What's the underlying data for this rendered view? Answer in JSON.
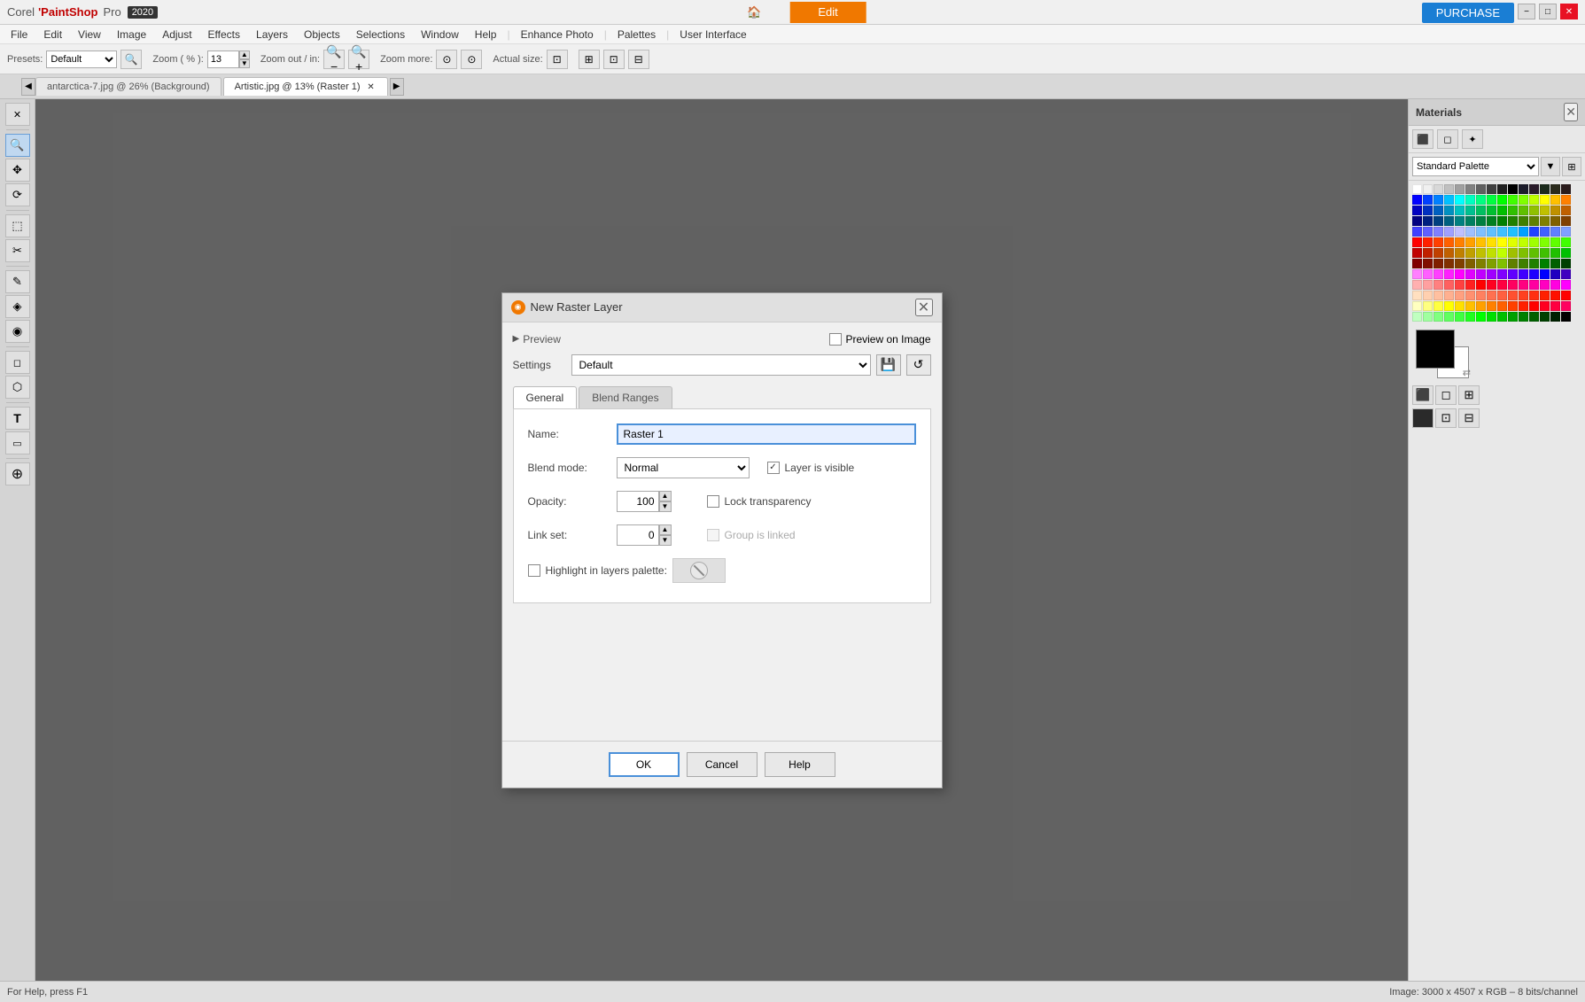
{
  "app": {
    "title": "Corel PaintShop Pro 2020",
    "corel": "Corel",
    "paintshop": "'PaintShop",
    "pro": "Pro",
    "year": "2020"
  },
  "titlebar": {
    "home_label": "🏠",
    "edit_label": "Edit",
    "purchase_label": "PURCHASE",
    "min_label": "−",
    "max_label": "□",
    "close_label": "✕"
  },
  "menubar": {
    "items": [
      "File",
      "Edit",
      "View",
      "Image",
      "Adjust",
      "Effects",
      "Layers",
      "Objects",
      "Selections",
      "Window",
      "Help",
      "Enhance Photo",
      "Palettes",
      "User Interface"
    ]
  },
  "toolbar": {
    "presets_label": "Presets:",
    "zoom_label": "Zoom ( % ):",
    "zoom_value": "13",
    "zoomout_label": "Zoom out / in:",
    "zoommore_label": "Zoom more:",
    "actualsize_label": "Actual size:"
  },
  "tabs": {
    "items": [
      {
        "label": "antarctica-7.jpg @ 26% (Background)",
        "active": false,
        "closable": false
      },
      {
        "label": "Artistic.jpg @ 13% (Raster 1)",
        "active": true,
        "closable": true
      }
    ]
  },
  "lefttools": {
    "tools": [
      "🔍",
      "⊹",
      "✏️",
      "🖊",
      "🔲",
      "✂",
      "◎",
      "✒",
      "⬡",
      "T",
      "🗑",
      "🪣"
    ]
  },
  "dialog": {
    "title": "New Raster Layer",
    "icon": "◉",
    "preview_label": "Preview",
    "preview_on_image_label": "Preview on Image",
    "settings_label": "Settings",
    "settings_default": "Default",
    "save_icon": "💾",
    "reset_icon": "↺",
    "tabs": [
      "General",
      "Blend Ranges"
    ],
    "active_tab": "General",
    "name_label": "Name:",
    "name_value": "Raster 1",
    "blend_label": "Blend mode:",
    "blend_value": "Normal",
    "opacity_label": "Opacity:",
    "opacity_value": "100",
    "linkset_label": "Link set:",
    "linkset_value": "0",
    "layer_visible_label": "Layer is visible",
    "lock_transparency_label": "Lock transparency",
    "group_linked_label": "Group is linked",
    "highlight_label": "Highlight in layers palette:",
    "ok_label": "OK",
    "cancel_label": "Cancel",
    "help_label": "Help"
  },
  "materials": {
    "title": "Materials",
    "close_icon": "✕",
    "palette_label": "Standard Palette",
    "swatches": [
      [
        "#ffffff",
        "#f0f0f0",
        "#d8d8d8",
        "#c0c0c0",
        "#a0a0a0",
        "#808080",
        "#606060",
        "#404040",
        "#202020",
        "#000000",
        "#1c1c2a",
        "#2a1c2a",
        "#1c2a1c",
        "#2a2a1c",
        "#2a1c1c"
      ],
      [
        "#0000ff",
        "#0040ff",
        "#0080ff",
        "#00c0ff",
        "#00ffff",
        "#00ffc0",
        "#00ff80",
        "#00ff40",
        "#00ff00",
        "#40ff00",
        "#80ff00",
        "#c0ff00",
        "#ffff00",
        "#ffc000",
        "#ff8000"
      ],
      [
        "#0000c0",
        "#0030c0",
        "#0060c0",
        "#0090c0",
        "#00c0c0",
        "#00c090",
        "#00c060",
        "#00c030",
        "#00c000",
        "#30c000",
        "#60c000",
        "#90c000",
        "#c0c000",
        "#c09000",
        "#c06000"
      ],
      [
        "#000080",
        "#002080",
        "#004080",
        "#006080",
        "#008080",
        "#008060",
        "#008040",
        "#008020",
        "#008000",
        "#208000",
        "#408000",
        "#608000",
        "#808000",
        "#806000",
        "#804000"
      ],
      [
        "#4040ff",
        "#6060ff",
        "#8080ff",
        "#a0a0ff",
        "#c0c0ff",
        "#a0c0ff",
        "#80c0ff",
        "#60c0ff",
        "#40c0ff",
        "#20c0ff",
        "#00a0ff",
        "#2040ff",
        "#4060ff",
        "#6080ff",
        "#80a0ff"
      ],
      [
        "#ff0000",
        "#ff2000",
        "#ff4000",
        "#ff6000",
        "#ff8000",
        "#ffa000",
        "#ffc000",
        "#ffe000",
        "#ffff00",
        "#e0ff00",
        "#c0ff00",
        "#a0ff00",
        "#80ff00",
        "#60ff00",
        "#40ff00"
      ],
      [
        "#c00000",
        "#c02000",
        "#c04000",
        "#c06000",
        "#c08000",
        "#c0a000",
        "#c0c000",
        "#c0e000",
        "#c0ff00",
        "#a0c000",
        "#80c000",
        "#60c000",
        "#40c000",
        "#20c000",
        "#00c000"
      ],
      [
        "#800000",
        "#801000",
        "#802000",
        "#803000",
        "#804000",
        "#806000",
        "#808000",
        "#80a000",
        "#80c000",
        "#608000",
        "#408000",
        "#208000",
        "#008000",
        "#006000",
        "#004000"
      ],
      [
        "#ff80ff",
        "#ff60ff",
        "#ff40ff",
        "#ff20ff",
        "#ff00ff",
        "#e000ff",
        "#c000ff",
        "#a000ff",
        "#8000ff",
        "#6000ff",
        "#4000ff",
        "#2000ff",
        "#0000ff",
        "#2000c0",
        "#4000c0"
      ],
      [
        "#ffb0b0",
        "#ffa0a0",
        "#ff8080",
        "#ff6060",
        "#ff4040",
        "#ff2020",
        "#ff0000",
        "#ff0020",
        "#ff0040",
        "#ff0060",
        "#ff0080",
        "#ff00a0",
        "#ff00c0",
        "#ff00e0",
        "#ff00ff"
      ],
      [
        "#ffe0c0",
        "#ffd0b0",
        "#ffc0a0",
        "#ffb090",
        "#ffa080",
        "#ff9070",
        "#ff8060",
        "#ff7050",
        "#ff6040",
        "#ff5030",
        "#ff4020",
        "#ff3010",
        "#ff2000",
        "#ff1000",
        "#ff0000"
      ],
      [
        "#ffffc0",
        "#ffff80",
        "#ffff40",
        "#ffff00",
        "#ffe000",
        "#ffc000",
        "#ffa000",
        "#ff8000",
        "#ff6000",
        "#ff4000",
        "#ff2000",
        "#ff0000",
        "#ff0020",
        "#ff0040",
        "#ff0060"
      ],
      [
        "#c0ffc0",
        "#a0ffa0",
        "#80ff80",
        "#60ff60",
        "#40ff40",
        "#20ff20",
        "#00ff00",
        "#00e000",
        "#00c000",
        "#00a000",
        "#008000",
        "#006000",
        "#004000",
        "#002000",
        "#000000"
      ]
    ],
    "fg_color": "#000000",
    "bg_color": "#ffffff"
  },
  "statusbar": {
    "help_text": "For Help, press F1",
    "image_info": "Image:  3000 x 4507 x RGB – 8 bits/channel"
  }
}
